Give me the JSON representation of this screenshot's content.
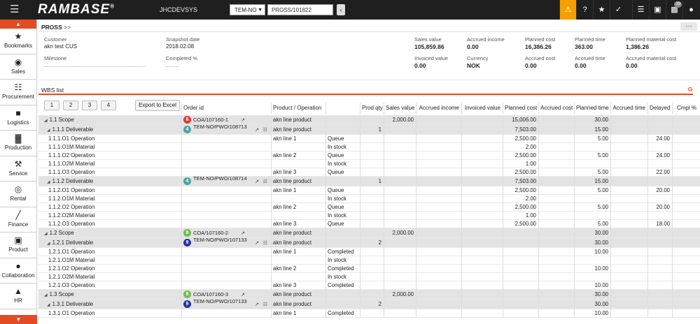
{
  "topbar": {
    "logo": "RAMBASE",
    "registered": "®",
    "system": "JHCDEVSYS",
    "company_select": "TEM-NO",
    "search_value": "PROSS/101822",
    "notification_count": "39"
  },
  "sidebar": {
    "items": [
      {
        "label": "Bookmarks",
        "icon": "star-icon"
      },
      {
        "label": "Sales",
        "icon": "sales-icon"
      },
      {
        "label": "Procurement",
        "icon": "cart-icon"
      },
      {
        "label": "Logistics",
        "icon": "truck-icon"
      },
      {
        "label": "Production",
        "icon": "factory-icon"
      },
      {
        "label": "Service",
        "icon": "wrench-icon"
      },
      {
        "label": "Rental",
        "icon": "rental-icon"
      },
      {
        "label": "Finance",
        "icon": "chart-icon"
      },
      {
        "label": "Product",
        "icon": "box-icon"
      },
      {
        "label": "Collaboration",
        "icon": "chat-icon"
      },
      {
        "label": "HR",
        "icon": "person-icon"
      }
    ]
  },
  "header": {
    "breadcrumb": "PROSS",
    "breadcrumb_suffix": ">>",
    "customer_label": "Customer",
    "customer_value": "akn test CUS",
    "snapshot_label": "Snapshot date",
    "snapshot_value": "2018.02.08",
    "milestone_label": "Milestone",
    "completed_label": "Completed %",
    "sales_value_label": "Sales value",
    "sales_value": "105,859.86",
    "accrued_income_label": "Accrued income",
    "accrued_income": "0.00",
    "planned_cost_label": "Planned cost",
    "planned_cost": "16,386.26",
    "planned_time_label": "Planned time",
    "planned_time": "363.00",
    "planned_material_label": "Planned material cost",
    "planned_material": "1,386.26",
    "invoiced_label": "Invoiced value",
    "invoiced": "0.00",
    "currency_label": "Currency",
    "currency": "NOK",
    "accrued_cost_label": "Accrued cost",
    "accrued_cost": "0.00",
    "accrued_time_label": "Accrued time",
    "accrued_time": "0.00",
    "accrued_material_label": "Accrued material cost",
    "accrued_material": "0.00"
  },
  "wbs": {
    "title": "WBS list",
    "level_buttons": [
      "1",
      "2",
      "3",
      "4"
    ],
    "export_button": "Export to Excel",
    "columns": [
      "Order id",
      "Product / Operation",
      "",
      "Prod qty",
      "Sales value",
      "Accrued income",
      "Invoiced value",
      "Planned cost",
      "Accrued cost",
      "Planned time",
      "Accrued time",
      "Delayed",
      "Cmpl %"
    ],
    "rows": [
      {
        "type": "scope",
        "id": "1.1",
        "name": "Scope",
        "badge": "6",
        "badge_color": "red",
        "order": "COA/107160-1",
        "product": "akn line product",
        "status": "",
        "qty": "",
        "sales": "2,000.00",
        "pcost": "15,006.00",
        "ptime": "30.00",
        "delayed": ""
      },
      {
        "type": "deliv",
        "id": "1.1.1",
        "name": "Deliverable",
        "badge": "4",
        "badge_color": "teal",
        "order": "TEM-NO/PWO/108713",
        "product": "akn line product",
        "status": "",
        "qty": "1",
        "sales": "",
        "pcost": "7,503.00",
        "ptime": "15.00",
        "delayed": ""
      },
      {
        "type": "op",
        "id": "1.1.1.O1",
        "name": "Operation",
        "order": "",
        "product": "akn line 1",
        "status": "Queue",
        "qty": "",
        "sales": "",
        "pcost": "2,500.00",
        "ptime": "5.00",
        "delayed": "24.00"
      },
      {
        "type": "op",
        "id": "1.1.1.O1M",
        "name": "Material",
        "order": "",
        "product": "",
        "status": "In stock",
        "qty": "",
        "sales": "",
        "pcost": "2.00",
        "ptime": "",
        "delayed": ""
      },
      {
        "type": "op",
        "id": "1.1.1.O2",
        "name": "Operation",
        "order": "",
        "product": "akn line 2",
        "status": "Queue",
        "qty": "",
        "sales": "",
        "pcost": "2,500.00",
        "ptime": "5.00",
        "delayed": "24.00"
      },
      {
        "type": "op",
        "id": "1.1.1.O2M",
        "name": "Material",
        "order": "",
        "product": "",
        "status": "In stock",
        "qty": "",
        "sales": "",
        "pcost": "1.00",
        "ptime": "",
        "delayed": ""
      },
      {
        "type": "op",
        "id": "1.1.1.O3",
        "name": "Operation",
        "order": "",
        "product": "akn line 3",
        "status": "Queue",
        "qty": "",
        "sales": "",
        "pcost": "2,500.00",
        "ptime": "5.00",
        "delayed": "22.00"
      },
      {
        "type": "deliv",
        "id": "1.1.2",
        "name": "Deliverable",
        "badge": "4",
        "badge_color": "teal",
        "order": "TEM-NO/PWO/108714",
        "product": "akn line product",
        "status": "",
        "qty": "1",
        "sales": "",
        "pcost": "7,503.00",
        "ptime": "15.00",
        "delayed": ""
      },
      {
        "type": "op",
        "id": "1.1.2.O1",
        "name": "Operation",
        "order": "",
        "product": "akn line 1",
        "status": "Queue",
        "qty": "",
        "sales": "",
        "pcost": "2,500.00",
        "ptime": "5.00",
        "delayed": "20.00"
      },
      {
        "type": "op",
        "id": "1.1.2.O1M",
        "name": "Material",
        "order": "",
        "product": "",
        "status": "In stock",
        "qty": "",
        "sales": "",
        "pcost": "2.00",
        "ptime": "",
        "delayed": ""
      },
      {
        "type": "op",
        "id": "1.1.2.O2",
        "name": "Operation",
        "order": "",
        "product": "akn line 2",
        "status": "Queue",
        "qty": "",
        "sales": "",
        "pcost": "2,500.00",
        "ptime": "5.00",
        "delayed": "20.00"
      },
      {
        "type": "op",
        "id": "1.1.2.O2M",
        "name": "Material",
        "order": "",
        "product": "",
        "status": "In stock",
        "qty": "",
        "sales": "",
        "pcost": "1.00",
        "ptime": "",
        "delayed": ""
      },
      {
        "type": "op",
        "id": "1.1.2.O3",
        "name": "Operation",
        "order": "",
        "product": "akn line 3",
        "status": "Queue",
        "qty": "",
        "sales": "",
        "pcost": "2,500.00",
        "ptime": "5.00",
        "delayed": "18.00"
      },
      {
        "type": "scope",
        "id": "1.2",
        "name": "Scope",
        "badge": "8",
        "badge_color": "green",
        "order": "COA/107160-2",
        "product": "akn line product",
        "status": "",
        "qty": "",
        "sales": "2,000.00",
        "pcost": "",
        "ptime": "30.00",
        "delayed": ""
      },
      {
        "type": "deliv",
        "id": "1.2.1",
        "name": "Deliverable",
        "badge": "9",
        "badge_color": "blue",
        "order": "TEM-NO/PWO/107133",
        "product": "akn line product",
        "status": "",
        "qty": "2",
        "sales": "",
        "pcost": "",
        "ptime": "30.00",
        "delayed": ""
      },
      {
        "type": "op",
        "id": "1.2.1.O1",
        "name": "Operation",
        "order": "",
        "product": "akn line 1",
        "status": "Completed",
        "qty": "",
        "sales": "",
        "pcost": "",
        "ptime": "10.00",
        "delayed": ""
      },
      {
        "type": "op",
        "id": "1.2.1.O1M",
        "name": "Material",
        "order": "",
        "product": "",
        "status": "In stock",
        "qty": "",
        "sales": "",
        "pcost": "",
        "ptime": "",
        "delayed": ""
      },
      {
        "type": "op",
        "id": "1.2.1.O2",
        "name": "Operation",
        "order": "",
        "product": "akn line 2",
        "status": "Completed",
        "qty": "",
        "sales": "",
        "pcost": "",
        "ptime": "10.00",
        "delayed": ""
      },
      {
        "type": "op",
        "id": "1.2.1.O2M",
        "name": "Material",
        "order": "",
        "product": "",
        "status": "In stock",
        "qty": "",
        "sales": "",
        "pcost": "",
        "ptime": "",
        "delayed": ""
      },
      {
        "type": "op",
        "id": "1.2.1.O3",
        "name": "Operation",
        "order": "",
        "product": "akn line 3",
        "status": "Completed",
        "qty": "",
        "sales": "",
        "pcost": "",
        "ptime": "10.00",
        "delayed": ""
      },
      {
        "type": "scope",
        "id": "1.3",
        "name": "Scope",
        "badge": "8",
        "badge_color": "green",
        "order": "COA/107160-3",
        "product": "akn line product",
        "status": "",
        "qty": "",
        "sales": "2,000.00",
        "pcost": "",
        "ptime": "30.00",
        "delayed": ""
      },
      {
        "type": "deliv",
        "id": "1.3.1",
        "name": "Deliverable",
        "badge": "9",
        "badge_color": "blue",
        "order": "TEM-NO/PWO/107133",
        "product": "akn line product",
        "status": "",
        "qty": "2",
        "sales": "",
        "pcost": "",
        "ptime": "30.00",
        "delayed": ""
      },
      {
        "type": "op",
        "id": "1.3.1.O1",
        "name": "Operation",
        "order": "",
        "product": "akn line 1",
        "status": "Completed",
        "qty": "",
        "sales": "",
        "pcost": "",
        "ptime": "10.00",
        "delayed": ""
      }
    ]
  },
  "colors": {
    "accent": "#e34b24",
    "warning": "#f5a000",
    "topbar": "#1f1f1f",
    "row_group": "#e3e3e3"
  }
}
